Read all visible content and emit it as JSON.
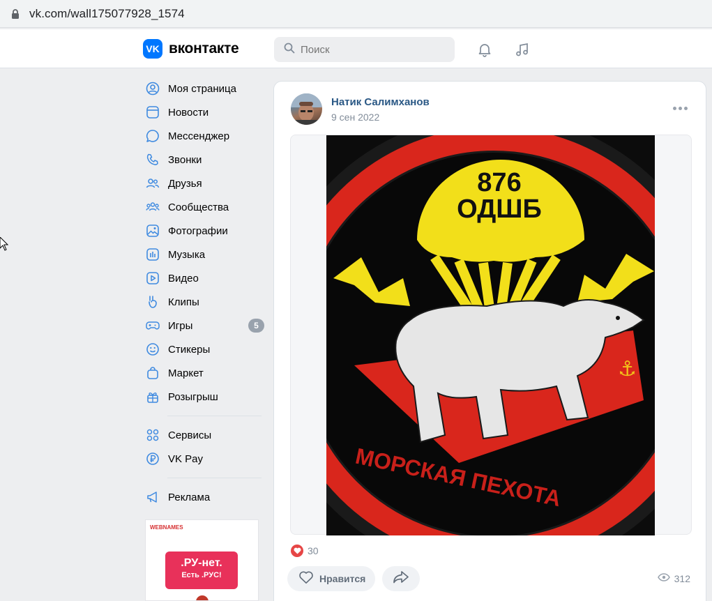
{
  "browser": {
    "url": "vk.com/wall175077928_1574"
  },
  "header": {
    "logo_badge": "VK",
    "logo_text": "вконтакте",
    "search_placeholder": "Поиск",
    "icons": [
      "bell-icon",
      "music-note-icon"
    ]
  },
  "sidebar": {
    "items": [
      {
        "label": "Моя страница",
        "icon": "profile-icon"
      },
      {
        "label": "Новости",
        "icon": "news-icon"
      },
      {
        "label": "Мессенджер",
        "icon": "chat-bubble-icon"
      },
      {
        "label": "Звонки",
        "icon": "phone-icon"
      },
      {
        "label": "Друзья",
        "icon": "friends-icon"
      },
      {
        "label": "Сообщества",
        "icon": "communities-icon"
      },
      {
        "label": "Фотографии",
        "icon": "photo-icon"
      },
      {
        "label": "Музыка",
        "icon": "music-icon"
      },
      {
        "label": "Видео",
        "icon": "video-icon"
      },
      {
        "label": "Клипы",
        "icon": "clips-icon"
      },
      {
        "label": "Игры",
        "icon": "gamepad-icon",
        "count": "5"
      },
      {
        "label": "Стикеры",
        "icon": "smile-icon"
      },
      {
        "label": "Маркет",
        "icon": "bag-icon"
      },
      {
        "label": "Розыгрыш",
        "icon": "gift-icon"
      }
    ],
    "secondary": [
      {
        "label": "Сервисы",
        "icon": "grid-icon"
      },
      {
        "label": "VK Pay",
        "icon": "ruble-icon"
      }
    ],
    "tertiary": [
      {
        "label": "Реклама",
        "icon": "megaphone-icon"
      }
    ],
    "ad": {
      "brand": "WEBNAMES",
      "line1": ".РУ-нет.",
      "line2": "Есть .РУС!"
    }
  },
  "post": {
    "author": "Натик Салимханов",
    "date": "9 сен 2022",
    "image_text": {
      "number": "876",
      "unit": "ОДШБ",
      "motto": "МОРСКАЯ ПЕХОТА"
    },
    "reactions_count": "30",
    "like_label": "Нравится",
    "views": "312"
  },
  "colors": {
    "accent": "#0077ff",
    "link": "#2a5885",
    "like": "#e64646",
    "muted": "#818c99"
  }
}
